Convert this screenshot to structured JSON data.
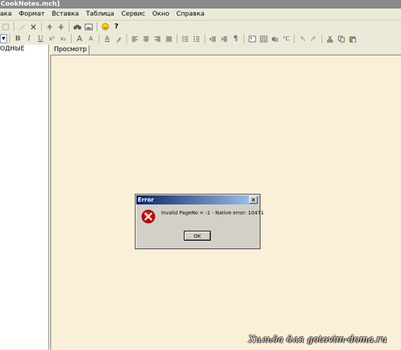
{
  "window": {
    "title": "CookNotes.mch]"
  },
  "menubar": {
    "items": [
      "ака",
      "Формат",
      "Вставка",
      "Таблица",
      "Сервис",
      "Окно",
      "Справка"
    ]
  },
  "toolbar1": {
    "icons": [
      "save-icon",
      "edit-icon",
      "delete-icon",
      "arrow-up-icon",
      "arrow-down-icon",
      "binoculars-icon",
      "picture-icon",
      "smiley-icon",
      "help-icon"
    ],
    "help_label": "?"
  },
  "toolbar2": {
    "bold": "B",
    "italic": "I",
    "underline": "U",
    "superscript": "x²",
    "subscript": "x₂",
    "font_larger": "A",
    "font_smaller": "A",
    "font_color": "A"
  },
  "left_pane": {
    "tree_item": "ОДНЫЕ"
  },
  "tabs": [
    {
      "label": "Просмотр"
    }
  ],
  "dialog": {
    "title": "Error",
    "close_label": "×",
    "message": "Invalid PageNo = -1 - Native error: 10471",
    "ok_label": "OK"
  },
  "watermark": {
    "text": "Хильда для gotovim-doma.ru"
  },
  "colors": {
    "content_bg": "#faf0d7",
    "dialog_title_start": "#0a246a",
    "dialog_title_end": "#a6caf0",
    "error_icon": "#cc0000"
  }
}
